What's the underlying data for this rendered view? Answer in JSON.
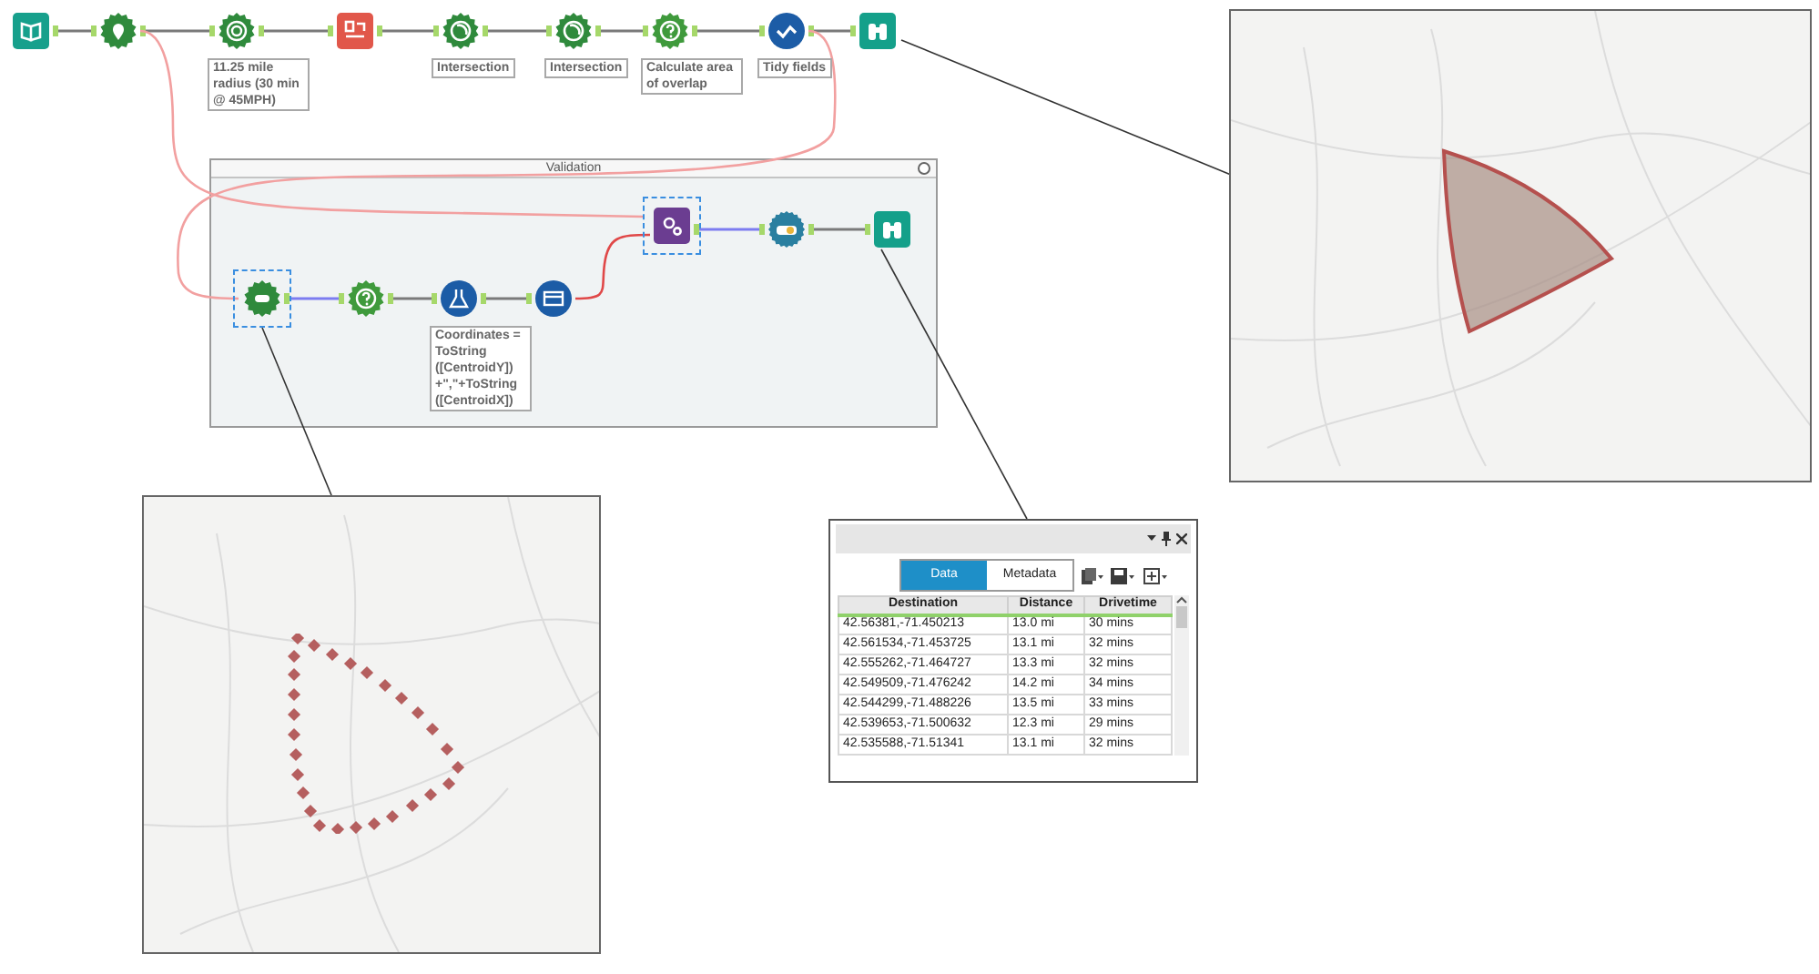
{
  "workflow": {
    "top_row": [
      {
        "kind": "text-input",
        "selected": false
      },
      {
        "kind": "create-points",
        "selected": false
      },
      {
        "kind": "trade-area",
        "selected": false,
        "annotation": "11.25 mile radius (30 min @ 45MPH)"
      },
      {
        "kind": "spatial-match",
        "selected": false
      },
      {
        "kind": "spatial-process",
        "selected": false,
        "annotation": "Intersection"
      },
      {
        "kind": "spatial-process",
        "selected": false,
        "annotation": "Intersection"
      },
      {
        "kind": "formula-check",
        "selected": false,
        "annotation": "Calculate area of overlap"
      },
      {
        "kind": "select",
        "selected": false,
        "annotation": "Tidy fields"
      },
      {
        "kind": "browse",
        "selected": false
      }
    ],
    "container": {
      "title": "Validation",
      "nodes": [
        {
          "kind": "create-polygon",
          "selected": true
        },
        {
          "kind": "formula-check",
          "selected": false
        },
        {
          "kind": "formula",
          "selected": false,
          "annotation": "Coordinates = ToString ([CentroidY]) +\",\"+ToString ([CentroidX])"
        },
        {
          "kind": "table",
          "selected": false
        },
        {
          "kind": "macro",
          "selected": true
        },
        {
          "kind": "drivetime",
          "selected": false
        },
        {
          "kind": "browse",
          "selected": false
        }
      ]
    }
  },
  "results": {
    "tabs": [
      {
        "label": "Data",
        "selected": true
      },
      {
        "label": "Metadata",
        "selected": false
      }
    ],
    "columns": [
      "Destination",
      "Distance",
      "Drivetime"
    ],
    "rows": [
      [
        "42.56381,-71.450213",
        "13.0 mi",
        "30 mins"
      ],
      [
        "42.561534,-71.453725",
        "13.1 mi",
        "32 mins"
      ],
      [
        "42.555262,-71.464727",
        "13.3 mi",
        "32 mins"
      ],
      [
        "42.549509,-71.476242",
        "14.2 mi",
        "34 mins"
      ],
      [
        "42.544299,-71.488226",
        "13.5 mi",
        "33 mins"
      ],
      [
        "42.539653,-71.500632",
        "12.3 mi",
        "29 mins"
      ],
      [
        "42.535588,-71.51341",
        "13.1 mi",
        "32 mins"
      ]
    ]
  }
}
